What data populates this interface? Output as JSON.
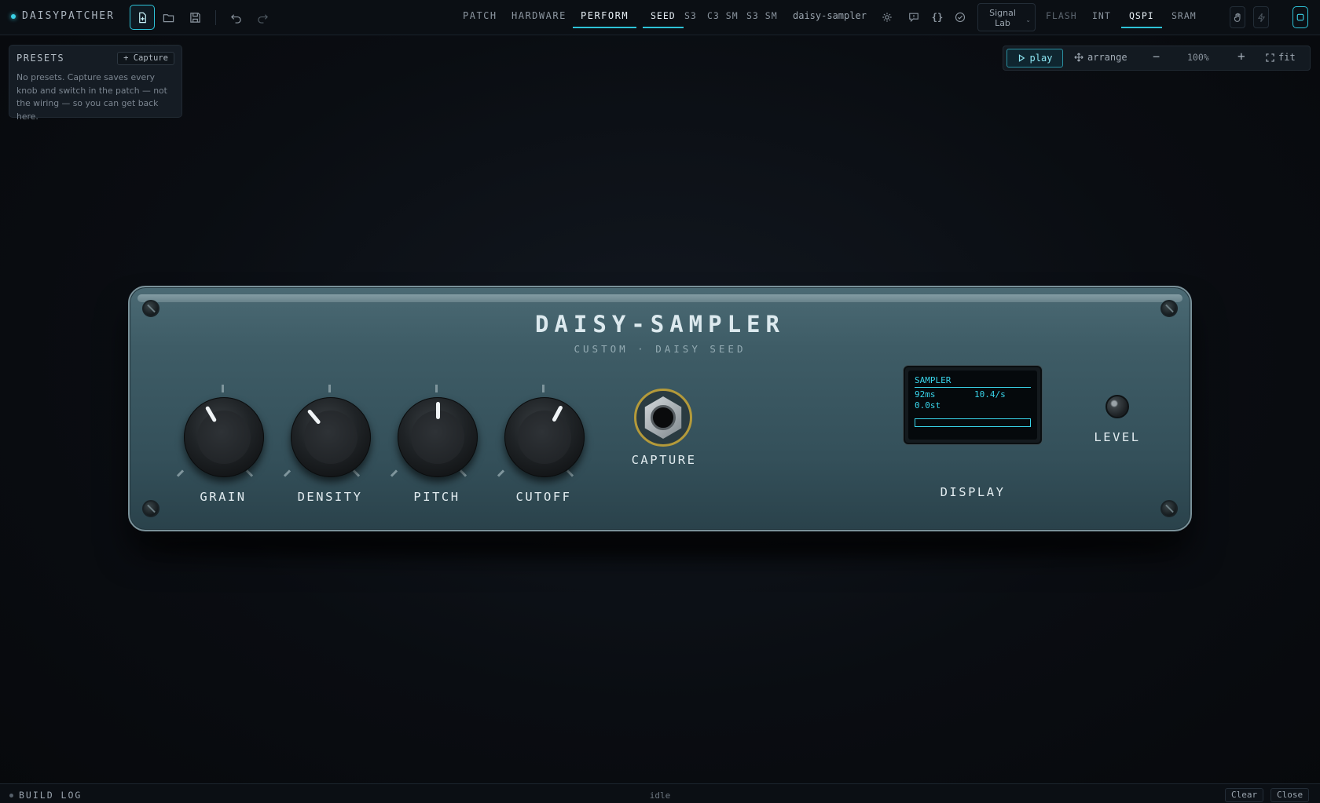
{
  "app": {
    "name": "DAISYPATCHER"
  },
  "toolbar": {
    "new_icon": "new-file-icon",
    "open_icon": "folder-icon",
    "save_icon": "save-icon",
    "undo_icon": "undo-icon",
    "redo_icon": "redo-icon"
  },
  "nav": {
    "tabs": [
      {
        "label": "PATCH",
        "active": false
      },
      {
        "label": "HARDWARE",
        "active": false
      },
      {
        "label": "PERFORM",
        "active": true
      }
    ],
    "boards": [
      {
        "label": "SEED",
        "active": true
      },
      {
        "label": "S3",
        "active": false
      },
      {
        "label": "C3 SM",
        "active": false
      },
      {
        "label": "S3 SM",
        "active": false
      }
    ],
    "project_name": "daisy-sampler",
    "lab_select": {
      "line1": "Signal",
      "line2": "Lab"
    },
    "memory": [
      {
        "label": "FLASH",
        "active": false,
        "dim": true
      },
      {
        "label": "INT",
        "active": false,
        "dim": false
      },
      {
        "label": "QSPI",
        "active": true,
        "dim": false
      },
      {
        "label": "SRAM",
        "active": false,
        "dim": false
      }
    ]
  },
  "presets": {
    "title": "PRESETS",
    "capture_label": "+ Capture",
    "empty_text": "No presets. Capture saves every knob and switch in the patch — not the wiring — so you can get back here."
  },
  "canvas_toolbar": {
    "play_label": "play",
    "arrange_label": "arrange",
    "zoom": "100%",
    "fit_label": "fit"
  },
  "device": {
    "title": "DAISY-SAMPLER",
    "subtitle": "CUSTOM · DAISY SEED",
    "knobs": [
      {
        "label": "GRAIN",
        "angle_deg": -30
      },
      {
        "label": "DENSITY",
        "angle_deg": -40
      },
      {
        "label": "PITCH",
        "angle_deg": 0
      },
      {
        "label": "CUTOFF",
        "angle_deg": 28
      }
    ],
    "jack_label": "CAPTURE",
    "display": {
      "label": "DISPLAY",
      "screen_title": "SAMPLER",
      "row1_left": "92ms",
      "row1_right": "10.4/s",
      "row2_left": "0.0st"
    },
    "led_label": "LEVEL",
    "colors": {
      "panel": "#3e5c66",
      "screen_text": "#39d4ea",
      "jack_ring": "#b49a3a"
    }
  },
  "build_log": {
    "title": "BUILD LOG",
    "status": "idle",
    "clear_label": "Clear",
    "close_label": "Close"
  },
  "accent_color": "#2ec3d8"
}
